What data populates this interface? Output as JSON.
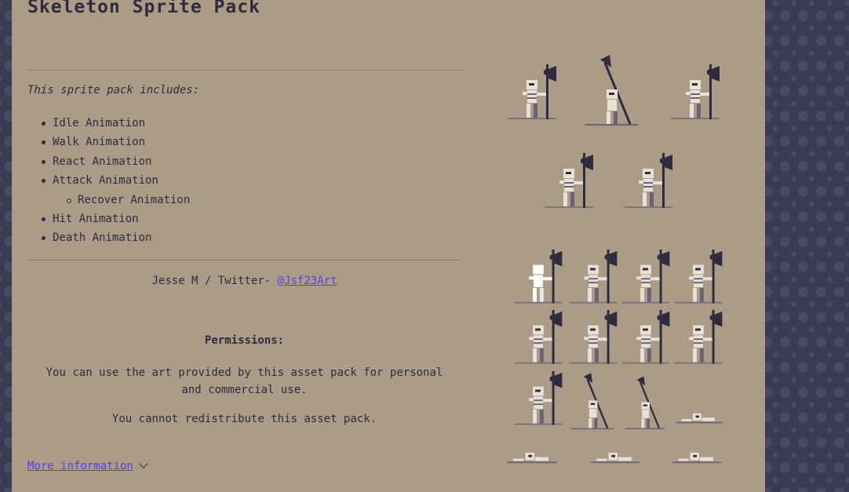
{
  "page": {
    "title": "Skeleton Sprite Pack",
    "intro": "This sprite pack includes:",
    "animations": [
      "Idle Animation",
      "Walk Animation",
      "React Animation",
      "Attack Animation",
      "Recover Animation",
      "Hit Animation",
      "Death Animation"
    ],
    "author_prefix": "Jesse M / Twitter- ",
    "author_link": "@Jsf23Art",
    "permissions_title": "Permissions:",
    "permission_personal": "You can use the art provided by this asset pack for personal and commercial use.",
    "permission_redistribute": "You cannot redistribute this asset pack.",
    "more_info": "More information"
  },
  "colors": {
    "background": "#3a3a52",
    "panel": "#ab9c88",
    "text": "#2f2b3e",
    "link": "#5a3ee8",
    "bone": "#e8e2d6",
    "shadow": "#6a6378",
    "weapon": "#2f2b3e"
  }
}
